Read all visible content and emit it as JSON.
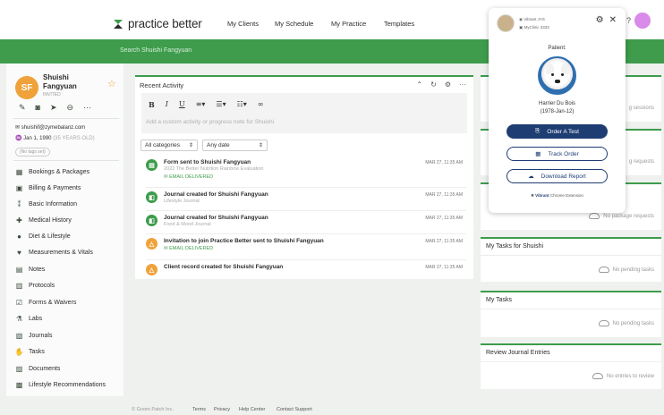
{
  "header": {
    "logo_text": "practice better",
    "nav": [
      "My Clients",
      "My Schedule",
      "My Practice",
      "Templates"
    ],
    "colors": {
      "brand": "#3e9c4c",
      "popup_primary": "#1e3d73",
      "avatar": "#f0a23a"
    }
  },
  "search": {
    "placeholder": "Search Shuishi Fangyuan"
  },
  "client": {
    "initials": "SF",
    "name": "Shuishi Fangyuan",
    "status": "INVITED",
    "email": "shuishif@zymebalanz.com",
    "dob": "Jan 1, 1990",
    "age": "(35 YEARS OLD)",
    "tags_button": "(No tags set)"
  },
  "sidebar": {
    "items": [
      {
        "label": "Bookings & Packages",
        "icon": "calendar-icon"
      },
      {
        "label": "Billing & Payments",
        "icon": "billing-icon"
      },
      {
        "label": "Basic Information",
        "icon": "info-icon"
      },
      {
        "label": "Medical History",
        "icon": "medical-icon"
      },
      {
        "label": "Diet & Lifestyle",
        "icon": "diet-icon"
      },
      {
        "label": "Measurements & Vitals",
        "icon": "heart-icon"
      },
      {
        "label": "Notes",
        "icon": "notes-icon"
      },
      {
        "label": "Protocols",
        "icon": "protocols-icon"
      },
      {
        "label": "Forms & Waivers",
        "icon": "checkbox-icon"
      },
      {
        "label": "Labs",
        "icon": "flask-icon"
      },
      {
        "label": "Journals",
        "icon": "journal-icon"
      },
      {
        "label": "Tasks",
        "icon": "tasks-icon"
      },
      {
        "label": "Documents",
        "icon": "documents-icon"
      },
      {
        "label": "Lifestyle Recommendations",
        "icon": "recommendations-icon"
      }
    ]
  },
  "activity": {
    "title": "Recent Activity",
    "editor_placeholder": "Add a custom activity or progress note for Shuishi",
    "filter_category": "All categories",
    "filter_date": "Any date",
    "feed": [
      {
        "title": "Form sent to Shuishi Fangyuan",
        "sub": "2022 The Better Nutrition Rainbow Evaluation",
        "badge": "EMAIL DELIVERED",
        "date": "MAR 27, 11:35 AM",
        "icon_color": "#3e9c4c",
        "icon": "form-icon"
      },
      {
        "title": "Journal created for Shuishi Fangyuan",
        "sub": "Lifestyle Journal",
        "badge": "",
        "date": "MAR 27, 11:35 AM",
        "icon_color": "#3e9c4c",
        "icon": "journal-icon"
      },
      {
        "title": "Journal created for Shuishi Fangyuan",
        "sub": "Food & Mood Journal",
        "badge": "",
        "date": "MAR 27, 11:35 AM",
        "icon_color": "#3e9c4c",
        "icon": "journal-icon"
      },
      {
        "title": "Invitation to join Practice Better sent to Shuishi Fangyuan",
        "sub": "",
        "badge": "EMAIL DELIVERED",
        "date": "MAR 27, 11:35 AM",
        "icon_color": "#f0a23a",
        "icon": "invite-icon"
      },
      {
        "title": "Client record created for Shuishi Fangyuan",
        "sub": "",
        "badge": "",
        "date": "MAR 27, 11:35 AM",
        "icon_color": "#f0a23a",
        "icon": "person-icon"
      }
    ]
  },
  "right_panels": [
    {
      "title": "",
      "empty": "g sessions"
    },
    {
      "title": "",
      "empty": "g requests"
    },
    {
      "title": "",
      "empty": "No package requests"
    },
    {
      "title": "My Tasks for Shuishi",
      "empty": "No pending tasks"
    },
    {
      "title": "My Tasks",
      "empty": "No pending tasks"
    },
    {
      "title": "Review Journal Entries",
      "empty": "No entries to review"
    }
  ],
  "popup": {
    "user_line1": "Vibrant JYS",
    "user_line2": "MyClinic 3333",
    "patient_label": "Patient:",
    "patient_name": "Harrier Du Bois",
    "patient_dob": "(1978-Jan-12)",
    "buttons": [
      "Order A Test",
      "Track Order",
      "Download Report"
    ],
    "ext_brand": "Vibrant",
    "ext_label": "Chrome Extension"
  },
  "footer": {
    "copyright": "© Green Patch Inc.",
    "links": [
      "Terms",
      "Privacy",
      "Help Center",
      "Contact Support"
    ]
  }
}
